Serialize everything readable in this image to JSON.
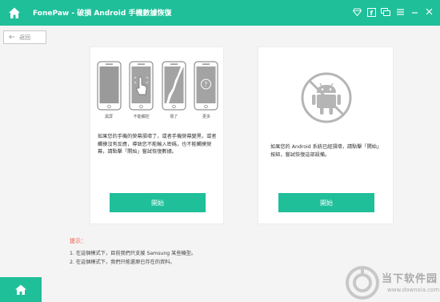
{
  "app": {
    "title": "FonePaw - 破損 Android 手機數據恢復",
    "accent_color": "#1fbf9a"
  },
  "titlebar_icons": [
    "diamond-icon",
    "facebook-icon",
    "chat-icon",
    "menu-icon",
    "minimize-icon",
    "close-icon"
  ],
  "back_button": {
    "label": "返回"
  },
  "left_panel": {
    "phones": [
      {
        "label": "黑屏",
        "icon": "black-screen-phone-icon"
      },
      {
        "label": "不能觸控",
        "icon": "touch-phone-icon"
      },
      {
        "label": "壞了",
        "icon": "broken-phone-icon"
      },
      {
        "label": "更多",
        "icon": "question-phone-icon"
      }
    ],
    "description": "如果您的手機的熒幕損壞了，或者手機熒幕變黑，或者觸摸沒有反應，導致您不能輸入密碼，也不能觸摸熒幕，請點擊「開始」嘗試恢復數據。",
    "start_label": "開始"
  },
  "right_panel": {
    "description": "如果您的 Android 系統已經損壞，請點擊「開始」按鈕，嘗試恢復這部設備。",
    "start_label": "開始",
    "icon": "no-android-icon"
  },
  "tips": {
    "title": "提示：",
    "items": [
      "1. 在這個模式下，目前我們只支援 Samsung 某些機型。",
      "2. 在這個模式下，我們只能還原已存在的資料。"
    ]
  },
  "watermark": {
    "text": "当下软件园",
    "url": "www.downxia.com"
  }
}
